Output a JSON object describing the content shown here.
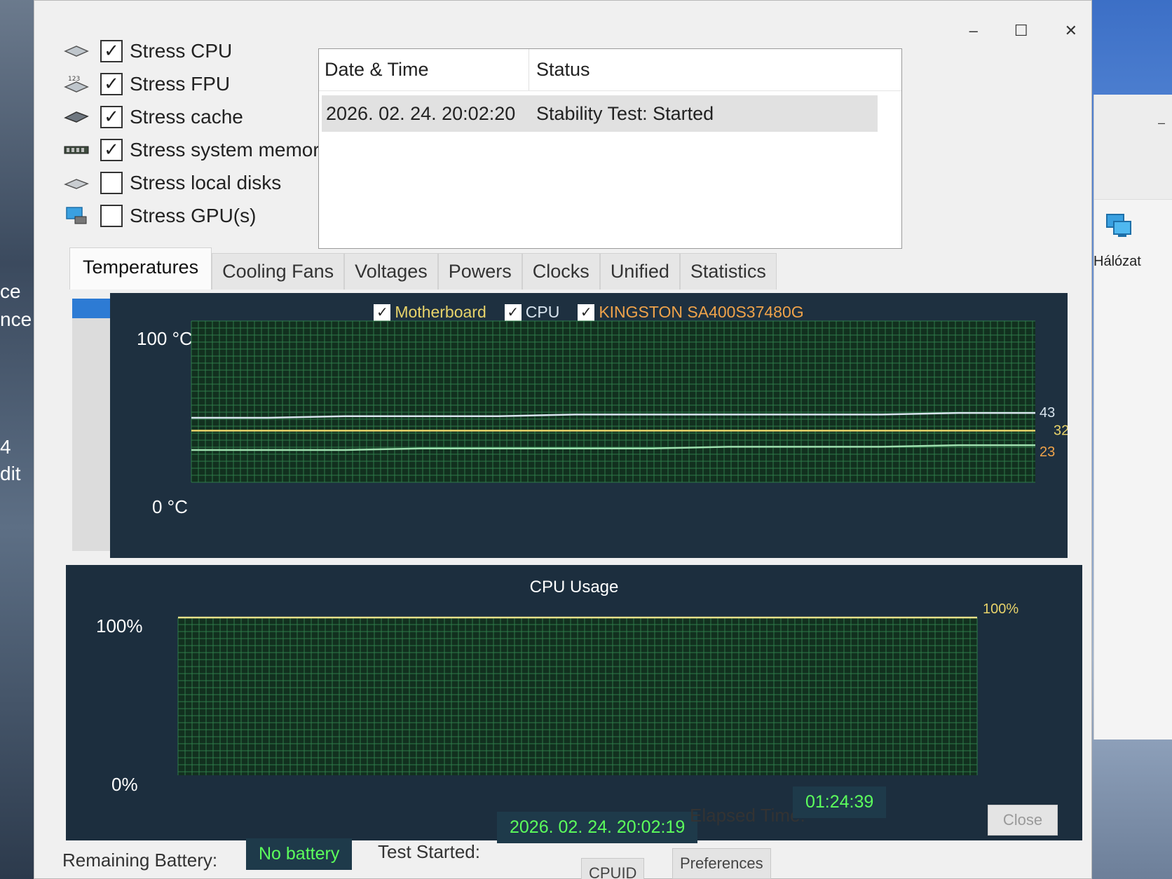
{
  "window": {
    "controls": {
      "minimize": "–",
      "maximize": "☐",
      "close": "✕"
    }
  },
  "stress_options": [
    {
      "label": "Stress CPU",
      "checked": true,
      "icon": "cpu-icon"
    },
    {
      "label": "Stress FPU",
      "checked": true,
      "icon": "fpu-icon"
    },
    {
      "label": "Stress cache",
      "checked": true,
      "icon": "cache-icon"
    },
    {
      "label": "Stress system memory",
      "checked": true,
      "icon": "memory-icon"
    },
    {
      "label": "Stress local disks",
      "checked": false,
      "icon": "disk-icon"
    },
    {
      "label": "Stress GPU(s)",
      "checked": false,
      "icon": "gpu-icon"
    }
  ],
  "log": {
    "headers": [
      "Date & Time",
      "Status"
    ],
    "rows": [
      [
        "2026. 02. 24. 20:02:20",
        "Stability Test: Started"
      ]
    ]
  },
  "tabs": [
    "Temperatures",
    "Cooling Fans",
    "Voltages",
    "Powers",
    "Clocks",
    "Unified",
    "Statistics"
  ],
  "active_tab": "Temperatures",
  "temperature_chart": {
    "legend": [
      {
        "label": "Motherboard",
        "checked": true,
        "color": "#e8d36a"
      },
      {
        "label": "CPU",
        "checked": true,
        "color": "#d8e4ee"
      },
      {
        "label": "KINGSTON SA400S37480G",
        "checked": true,
        "color": "#f0a34a"
      }
    ],
    "y_max_label": "100 °C",
    "y_min_label": "0 °C",
    "current_values": [
      "43",
      "32",
      "23"
    ]
  },
  "cpu_chart": {
    "title": "CPU Usage",
    "y_max_label": "100%",
    "y_min_label": "0%",
    "current_value": "100%"
  },
  "chart_data": [
    {
      "type": "line",
      "ylim": [
        0,
        100
      ],
      "series": [
        {
          "name": "Motherboard",
          "values": [
            32,
            32,
            32,
            32,
            32,
            32,
            32,
            32,
            32,
            32,
            32,
            32
          ],
          "color": "#e8d36a"
        },
        {
          "name": "CPU",
          "values": [
            40,
            40,
            41,
            41,
            41,
            42,
            42,
            42,
            42,
            42,
            43,
            43
          ],
          "color": "#d8e4ee"
        },
        {
          "name": "KINGSTON SA400S37480G",
          "values": [
            20,
            20,
            20,
            21,
            21,
            21,
            21,
            22,
            22,
            22,
            23,
            23
          ],
          "color": "#9fe0b0"
        }
      ]
    },
    {
      "type": "line",
      "title": "CPU Usage",
      "ylim": [
        0,
        100
      ],
      "series": [
        {
          "name": "CPU Usage",
          "values": [
            100,
            100,
            100,
            100,
            100,
            100,
            100,
            100,
            100,
            100,
            100,
            100
          ],
          "color": "#e8e28a"
        }
      ]
    }
  ],
  "bottom": {
    "battery_label": "Remaining Battery:",
    "battery_value": "No battery",
    "test_started_label": "Test Started:",
    "test_started_value": "2026. 02. 24. 20:02:19",
    "elapsed_label": "Elapsed Time:",
    "elapsed_value": "01:24:39",
    "close_label": "Close",
    "preferences_label": "Preferences",
    "cpuid_label": "CPUID"
  },
  "desktop": {
    "network_label": "Hálózat",
    "left_texts": [
      "ce",
      "nce",
      "4",
      "dit"
    ]
  }
}
